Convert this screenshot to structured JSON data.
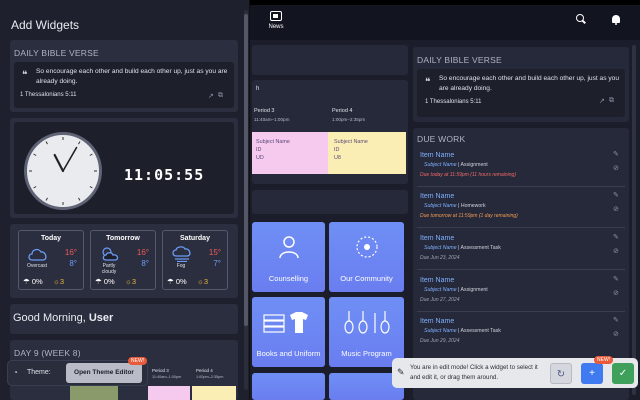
{
  "topbar": {
    "news_label": "News",
    "icons": [
      "newspaper-icon",
      "search-icon",
      "bell-icon"
    ]
  },
  "main": {
    "verse": {
      "title": "DAILY BIBLE VERSE",
      "text": "So encourage each other and build each other up, just as you are already doing.",
      "ref": "1 Thessalonians 5:11"
    },
    "timetable": {
      "periods": [
        {
          "name": "Period 3",
          "time": "11:40am–1:00pm"
        },
        {
          "name": "Period 4",
          "time": "1:00pm–2:35pm"
        }
      ],
      "cells": [
        {
          "subject": "Subject Name",
          "id": "ID",
          "room": "UD",
          "color": "#f6c9ee"
        },
        {
          "subject": "Subject Name",
          "id": "ID",
          "room": "U8",
          "color": "#fbeeb4"
        }
      ]
    },
    "tiles": [
      {
        "label": "Counselling",
        "icon": "counselling-icon"
      },
      {
        "label": "Our Community",
        "icon": "community-icon"
      },
      {
        "label": "Books and Uniform",
        "icon": "books-uniform-icon"
      },
      {
        "label": "Music Program",
        "icon": "music-icon"
      }
    ],
    "due_work": {
      "title": "DUE WORK",
      "items": [
        {
          "title": "Item Name",
          "subject": "Subject Name",
          "kind": "Assignment",
          "due": "Due today at 11:59pm (11 hours remaining)",
          "due_style": "red"
        },
        {
          "title": "Item Name",
          "subject": "Subject Name",
          "kind": "Homework",
          "due": "Due tomorrow at 11:59pm (1 day remaining)",
          "due_style": "orange"
        },
        {
          "title": "Item Name",
          "subject": "Subject Name",
          "kind": "Assessment Task",
          "due": "Due Jun 23, 2024",
          "due_style": "gray"
        },
        {
          "title": "Item Name",
          "subject": "Subject Name",
          "kind": "Assignment",
          "due": "Due Jun 27, 2024",
          "due_style": "gray"
        },
        {
          "title": "Item Name",
          "subject": "Subject Name",
          "kind": "Assessment Task",
          "due": "Due Jun 29, 2024",
          "due_style": "gray"
        }
      ]
    }
  },
  "panel": {
    "title": "Add Widgets",
    "verse": {
      "title": "DAILY BIBLE VERSE",
      "text": "So encourage each other and build each other up, just as you are already doing.",
      "ref": "1 Thessalonians 5:11"
    },
    "clock": {
      "time": "11:05:55",
      "hour": 11,
      "minute": 5
    },
    "weather": [
      {
        "day": "Today",
        "condition": "Overcast",
        "high": "16°",
        "low": "8°",
        "rain": "0%",
        "uv": "3",
        "icon": "cloud-icon"
      },
      {
        "day": "Tomorrow",
        "condition": "Partly cloudy",
        "high": "16°",
        "low": "8°",
        "rain": "0%",
        "uv": "3",
        "icon": "partly-cloudy-icon"
      },
      {
        "day": "Saturday",
        "condition": "Fog",
        "high": "15°",
        "low": "7°",
        "rain": "0%",
        "uv": "3",
        "icon": "fog-icon"
      }
    ],
    "greeting": {
      "text": "Good Morning,",
      "name": "User"
    },
    "day_label": "DAY 9 (WEEK 8)",
    "mini_periods": [
      {
        "name": "Period 3",
        "time": "11:40am–1:00pm"
      },
      {
        "name": "Period 4",
        "time": "1:00pm–2:35pm"
      }
    ]
  },
  "theme_bar": {
    "label": "Theme:",
    "button": "Open Theme Editor",
    "badge": "NEW!"
  },
  "edit_bar": {
    "text": "You are in edit mode! Click a widget to select it and edit it, or drag them around.",
    "badge": "NEW!"
  },
  "colors": {
    "accent": "#6c8bf5",
    "background": "#1b1d2a",
    "card": "#262939",
    "danger": "#ef6a6a",
    "warning": "#f29b54",
    "link": "#7fb0ff"
  }
}
